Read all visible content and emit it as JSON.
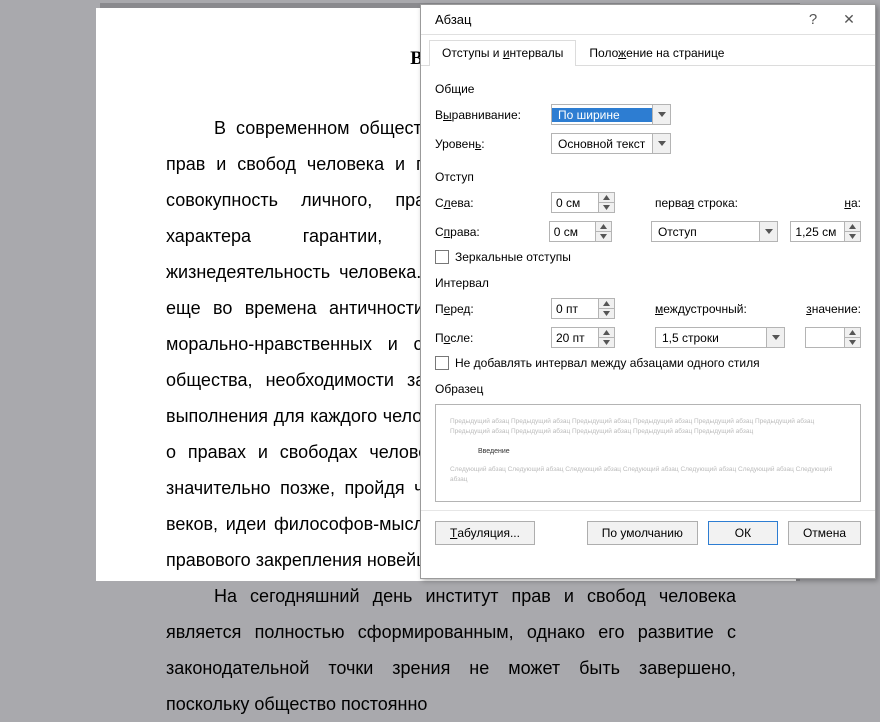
{
  "document": {
    "title": "Введение",
    "p1": "В современном обществе особое место отведено системе прав и свобод человека и гражданина, представляющей собой совокупность личного, правового, социально-экономического характера гарантии, обеспечивающие нормальную жизнедеятельность человека. Само понятие человека появилось еще во времена античности, когда появились первые идеи о морально-нравственных и социальных нормах существования общества, необходимости защиты этих правил и гарантии их выполнения для каждого человека. Однако окончательное понятие о правах и свободах человека и гражданина сформировалось значительно позже, пройдя через религиозные догматы средних веков, идеи философов-мыслителей эпохи возрождения, попытки правового закрепления новейшей истории.",
    "p2": "На сегодняшний день институт прав и свобод человека является полностью сформированным, однако его развитие с законодательной точки зрения не может быть завершено, поскольку общество постоянно"
  },
  "dialog": {
    "title": "Абзац",
    "tabs": {
      "t1_pre": "Отступы и ",
      "t1_u": "и",
      "t1_post": "нтервалы",
      "t2": "Поло",
      "t2_u": "ж",
      "t2_post": "ение на странице"
    },
    "general": {
      "head": "Общие",
      "align_lbl": "В",
      "align_u": "ы",
      "align_post": "равнивание:",
      "align_val": "По ширине",
      "level_lbl": "Уровен",
      "level_u": "ь",
      "level_post": ":",
      "level_val": "Основной текст"
    },
    "indent": {
      "head": "Отступ",
      "left_lbl": "С",
      "left_u": "л",
      "left_post": "ева:",
      "left_val": "0 см",
      "right_lbl": "С",
      "right_u": "п",
      "right_post": "рава:",
      "right_val": "0 см",
      "first_lbl": "перва",
      "first_u": "я",
      "first_post": " строка:",
      "first_val": "Отступ",
      "by_u": "н",
      "by_post": "а:",
      "by_val": "1,25 см",
      "mirror": "Зеркальные отступы"
    },
    "spacing": {
      "head": "Интервал",
      "before_lbl": "П",
      "before_u": "е",
      "before_post": "ред:",
      "before_val": "0 пт",
      "after_lbl": "П",
      "after_u": "о",
      "after_post": "сле:",
      "after_val": "20 пт",
      "line_lbl": "",
      "line_u": "м",
      "line_post": "еждустрочный:",
      "line_val": "1,5 строки",
      "val_lbl": "",
      "val_u": "з",
      "val_post": "начение:",
      "val_val": "",
      "nosame": "Не добавлять интервал между абзацами одного стиля"
    },
    "preview": {
      "head": "Образец",
      "prev": "Предыдущий абзац Предыдущий абзац Предыдущий абзац Предыдущий абзац Предыдущий абзац Предыдущий абзац Предыдущий абзац Предыдущий абзац Предыдущий абзац Предыдущий абзац Предыдущий абзац",
      "sample": "Введение",
      "next": "Следующий абзац Следующий абзац Следующий абзац Следующий абзац Следующий абзац Следующий абзац Следующий абзац"
    },
    "buttons": {
      "tabs": "Табуляция...",
      "default": "По умолчанию",
      "ok": "ОК",
      "cancel": "Отмена"
    }
  }
}
